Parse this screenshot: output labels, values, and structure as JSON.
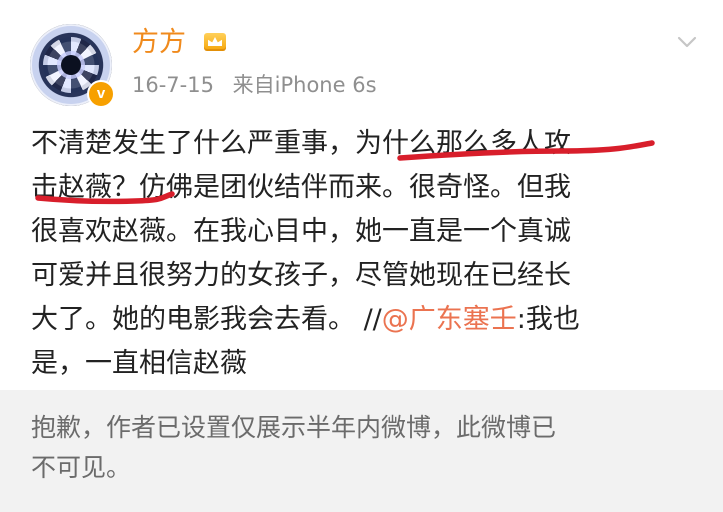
{
  "post": {
    "username": "方方",
    "time": "16-7-15",
    "source": "来自iPhone 6s",
    "vip_icon": "vip-crown-icon",
    "verified_badge": "v",
    "content": {
      "line1": "不清楚发生了什么严重事，为什么那么多人攻",
      "line2": "击赵薇？仿佛是团伙结伴而来。很奇怪。但我",
      "line3": "很喜欢赵薇。在我心目中，她一直是一个真诚",
      "line4": "可爱并且很努力的女孩子，尽管她现在已经长",
      "line5_text": "大了。她的电影我会去看。 //",
      "line5_mention": "@广东塞壬",
      "line5_tail": ":我也",
      "line6": "是，一直相信赵薇"
    },
    "highlight_color": "#d81e2b"
  },
  "notice": {
    "line1": "抱歉，作者已设置仅展示半年内微博，此微博已",
    "line2": "不可见。"
  },
  "colors": {
    "username": "#f08a1c",
    "mention": "#eb7350",
    "notice_bg": "#f2f2f2"
  }
}
